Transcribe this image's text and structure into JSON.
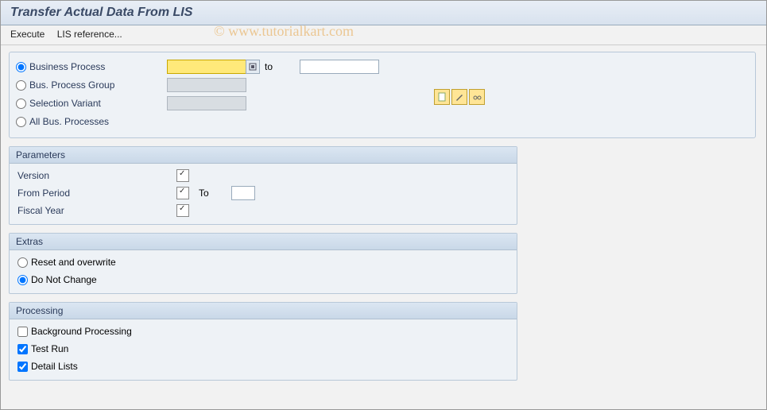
{
  "title": "Transfer Actual Data From LIS",
  "toolbar": {
    "execute": "Execute",
    "lis_ref": "LIS reference..."
  },
  "watermark": "© www.tutorialkart.com",
  "selection": {
    "radios": {
      "business_process": "Business Process",
      "bus_process_group": "Bus. Process Group",
      "selection_variant": "Selection Variant",
      "all_bus_processes": "All Bus. Processes"
    },
    "to_label": "to",
    "bp_from": "",
    "bp_to": "",
    "group_val": "",
    "variant_val": ""
  },
  "parameters": {
    "header": "Parameters",
    "version_label": "Version",
    "from_period_label": "From Period",
    "to_label": "To",
    "to_value": "",
    "fiscal_year_label": "Fiscal Year"
  },
  "extras": {
    "header": "Extras",
    "reset": "Reset and overwrite",
    "do_not_change": "Do Not Change"
  },
  "processing": {
    "header": "Processing",
    "background": "Background Processing",
    "test_run": "Test Run",
    "detail_lists": "Detail Lists"
  }
}
